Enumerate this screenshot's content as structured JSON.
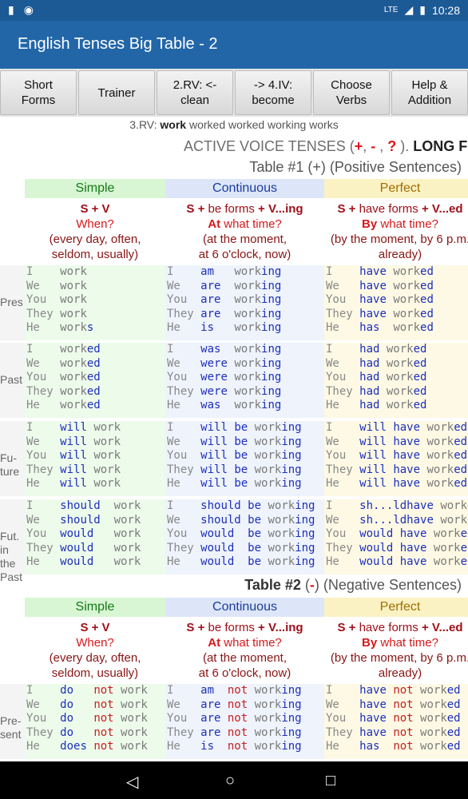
{
  "status": {
    "time": "10:28",
    "signal": "LTE"
  },
  "app": {
    "title": "English Tenses Big Table - 2"
  },
  "buttons": [
    {
      "label": "Short\nForms"
    },
    {
      "label": "Trainer"
    },
    {
      "label": "2.RV: <-\nclean"
    },
    {
      "label": "-> 4.IV:\nbecome"
    },
    {
      "label": "Choose\nVerbs"
    },
    {
      "label": "Help &\nAddition"
    }
  ],
  "rv_line": {
    "prefix": "3.RV:",
    "verb": "work",
    "forms": "worked worked working works"
  },
  "heading": {
    "text": "ACTIVE VOICE TENSES (",
    "plus": "+",
    "sep1": ", ",
    "minus": "-",
    "sep2": " , ",
    "q": "?",
    "after": " ). ",
    "long": "LONG F"
  },
  "table1": {
    "title": "Table #1 (+) (Positive Sentences)"
  },
  "table2": {
    "title_bold": "Table #2",
    "open": " (",
    "minus": "-",
    "close": ") (Negative Sentences)"
  },
  "columns": {
    "simple": {
      "name": "Simple",
      "formula": "S + V",
      "question": "When?",
      "note1": "(every day, often,",
      "note2": "seldom, usually)"
    },
    "continuous": {
      "name": "Continuous",
      "formula_a": "S + ",
      "formula_b": "be forms",
      "formula_c": " + V...ing",
      "question_a": "At",
      "question_b": " what time?",
      "note1": "(at the moment,",
      "note2": "at 6 o'clock, now)"
    },
    "perfect": {
      "name": "Perfect",
      "formula_a": "S + ",
      "formula_b": "have forms",
      "formula_c": " + V...ed",
      "question_a": "By",
      "question_b": " what time?",
      "note1": "(by the moment, by 6 p.m.",
      "note2": "already)"
    }
  },
  "row_labels": {
    "present": "Pres",
    "past": "Past",
    "future": "Fu-\nture",
    "future_past": "Fut.\nin\nthe\nPast",
    "present2": "Pre-\nsent"
  },
  "pronouns": [
    "I",
    "We",
    "You",
    "They",
    "He"
  ],
  "t1_present_simple": [
    "work",
    "work",
    "work",
    "work",
    "works"
  ],
  "t1_present_cont_aux": [
    "am",
    "are",
    "are",
    "are",
    "is"
  ],
  "t1_present_perf_aux": [
    "have",
    "have",
    "have",
    "have",
    "has"
  ],
  "t1_past_cont_aux": [
    "was",
    "were",
    "were",
    "were",
    "was"
  ],
  "t1_future_past_aux": [
    "should",
    "should",
    "would",
    "would",
    "would"
  ],
  "t1_future_past_perf_aux": [
    "sh...ld",
    "sh...ld",
    "would",
    "would",
    "would"
  ],
  "t2_present_simple_aux": [
    "do",
    "do",
    "do",
    "do",
    "does"
  ],
  "verbs": {
    "work": "work",
    "worked": "worked",
    "working": "working",
    "will": "will",
    "had": "had",
    "be": "be",
    "have": "have",
    "not": "not",
    "s": "s",
    "ed": "ed",
    "ing": "ing",
    "stem": "work"
  },
  "colors": {
    "appbar": "#2266a8",
    "simple_bg": "#edfbeb",
    "continuous_bg": "#eef3fc",
    "perfect_bg": "#fdf9e4",
    "aux": "#1d2fbb",
    "negative": "#c62020"
  }
}
